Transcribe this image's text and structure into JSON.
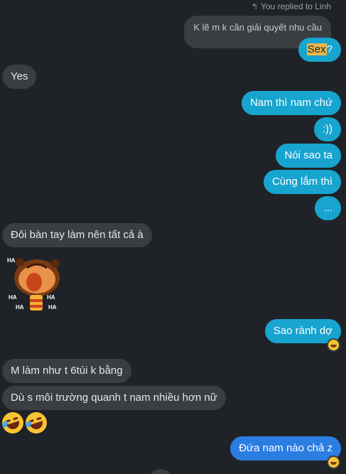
{
  "reply_note": {
    "text": "You replied to Linh"
  },
  "quoted_message": {
    "text": "K lẽ m k cần giải quyết nhu cầu"
  },
  "messages": [
    {
      "id": "sex",
      "pre": "",
      "highlight": "Sex",
      "post": "?"
    },
    {
      "id": "yes",
      "text": "Yes"
    },
    {
      "id": "nam-thi",
      "text": "Nam thì nam chứ"
    },
    {
      "id": "smile",
      "text": ":))"
    },
    {
      "id": "noi-sao-ta",
      "text": "Nói sao ta"
    },
    {
      "id": "cung-lam-thi",
      "text": "Cùng lắm thì"
    },
    {
      "id": "dots",
      "text": "..."
    },
    {
      "id": "doi-ban-tay",
      "text": "Đôi bàn tay làm nên tất cả à"
    },
    {
      "id": "sao-ranh-do",
      "text": "Sao rành dợ"
    },
    {
      "id": "m-lam-nhu",
      "text": "M làm như t 6túi k bằng"
    },
    {
      "id": "du-s-moi",
      "text": "Dù s môi trường quanh t nam nhiều hơn nữ"
    },
    {
      "id": "dua-nam-nao",
      "text": "Đứa nam nào chả z"
    }
  ],
  "sticker": {
    "labels": [
      "HA",
      "HA",
      "HA",
      "HA",
      "HA"
    ]
  },
  "colors": {
    "background": "#1f2226",
    "incoming": "#3a3d42",
    "outgoing_cyan": "#17a4cf",
    "outgoing_blue": "#2a7de1",
    "highlight": "#e9b64a"
  }
}
